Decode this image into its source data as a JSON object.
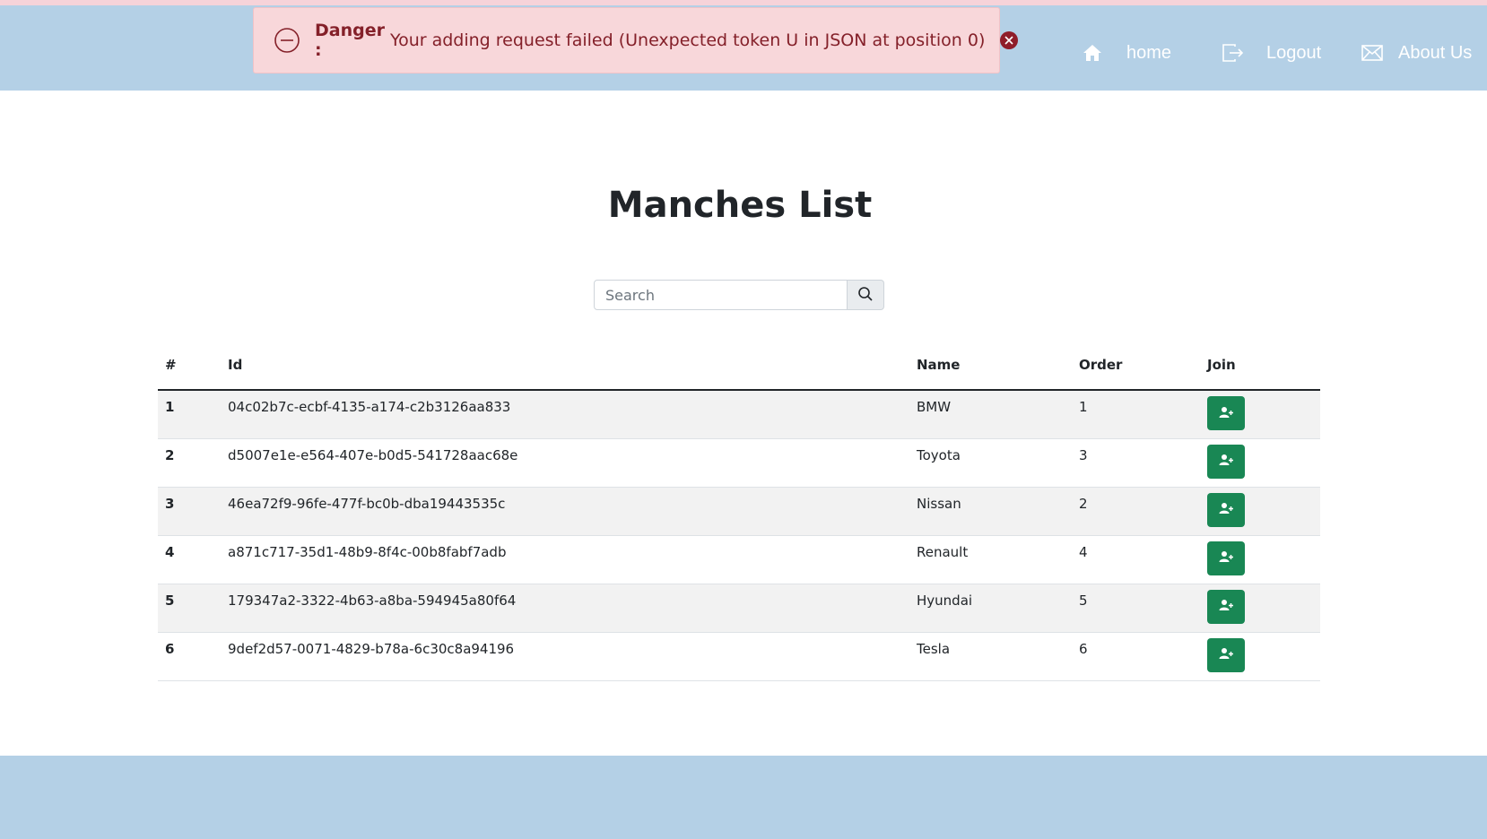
{
  "alert": {
    "label": "Danger :",
    "message": "Your adding request failed (Unexpected token U in JSON at position 0)"
  },
  "nav": {
    "home": "home",
    "logout": "Logout",
    "about": "About Us"
  },
  "page": {
    "title": "Manches List"
  },
  "search": {
    "placeholder": "Search",
    "value": ""
  },
  "table": {
    "headers": {
      "num": "#",
      "id": "Id",
      "name": "Name",
      "order": "Order",
      "join": "Join"
    },
    "rows": [
      {
        "num": "1",
        "id": "04c02b7c-ecbf-4135-a174-c2b3126aa833",
        "name": "BMW",
        "order": "1"
      },
      {
        "num": "2",
        "id": "d5007e1e-e564-407e-b0d5-541728aac68e",
        "name": "Toyota",
        "order": "3"
      },
      {
        "num": "3",
        "id": "46ea72f9-96fe-477f-bc0b-dba19443535c",
        "name": "Nissan",
        "order": "2"
      },
      {
        "num": "4",
        "id": "a871c717-35d1-48b9-8f4c-00b8fabf7adb",
        "name": "Renault",
        "order": "4"
      },
      {
        "num": "5",
        "id": "179347a2-3322-4b63-a8ba-594945a80f64",
        "name": "Hyundai",
        "order": "5"
      },
      {
        "num": "6",
        "id": "9def2d57-0071-4829-b78a-6c30c8a94196",
        "name": "Tesla",
        "order": "6"
      }
    ]
  },
  "icons": {
    "alert": "minus-circle-icon",
    "alert_close": "close-circle-icon",
    "home": "home-icon",
    "logout": "logout-icon",
    "about": "envelope-icon",
    "search": "search-icon",
    "join": "user-plus-icon"
  },
  "colors": {
    "header_bg": "#b4d0e6",
    "alert_bg": "#f8d7da",
    "alert_text": "#842029",
    "join_button": "#198754"
  }
}
